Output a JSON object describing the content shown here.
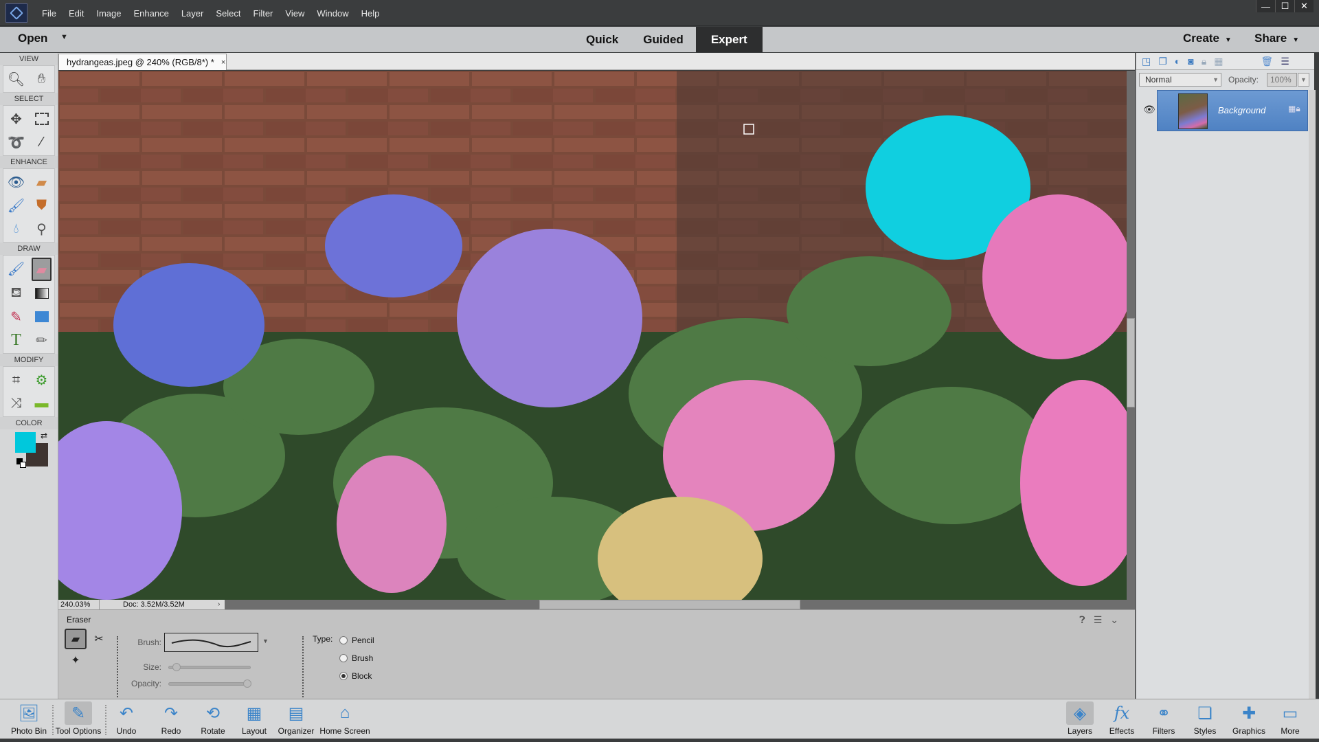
{
  "menu": [
    "File",
    "Edit",
    "Image",
    "Enhance",
    "Layer",
    "Select",
    "Filter",
    "View",
    "Window",
    "Help"
  ],
  "window_controls": {
    "minimize": "—",
    "maximize": "☐",
    "close": "✕"
  },
  "modebar": {
    "open": "Open",
    "modes": [
      "Quick",
      "Guided",
      "Expert"
    ],
    "active_mode": "Expert",
    "create": "Create",
    "share": "Share"
  },
  "document": {
    "tab_title": "hydrangeas.jpeg @ 240% (RGB/8*) *",
    "close": "×",
    "zoom": "240.03%",
    "doc_size": "Doc: 3.52M/3.52M"
  },
  "toolbox": {
    "sections": {
      "view": "VIEW",
      "select": "SELECT",
      "enhance": "ENHANCE",
      "draw": "DRAW",
      "modify": "MODIFY",
      "color": "COLOR"
    },
    "foreground_color": "#00c8dc",
    "background_color": "#3e3430",
    "active_tool": "eraser"
  },
  "tool_options": {
    "title": "Eraser",
    "brush_label": "Brush:",
    "size_label": "Size:",
    "opacity_label": "Opacity:",
    "type_label": "Type:",
    "size_value_fraction": 0.05,
    "opacity_value_fraction": 1.0,
    "types": [
      {
        "label": "Pencil",
        "selected": false
      },
      {
        "label": "Brush",
        "selected": false
      },
      {
        "label": "Block",
        "selected": true
      }
    ]
  },
  "layers_panel": {
    "blend_mode": "Normal",
    "opacity_label": "Opacity:",
    "opacity_value": "100%",
    "layers": [
      {
        "name": "Background",
        "visible": true,
        "locked": true
      }
    ]
  },
  "bottom_left": [
    {
      "label": "Photo Bin",
      "icon": "photo-bin-icon"
    },
    {
      "label": "Tool Options",
      "icon": "tool-options-icon",
      "active": true
    },
    {
      "label": "Undo",
      "icon": "undo-icon"
    },
    {
      "label": "Redo",
      "icon": "redo-icon"
    },
    {
      "label": "Rotate",
      "icon": "rotate-icon"
    },
    {
      "label": "Layout",
      "icon": "layout-icon"
    },
    {
      "label": "Organizer",
      "icon": "organizer-icon"
    },
    {
      "label": "Home Screen",
      "icon": "home-icon"
    }
  ],
  "bottom_right": [
    {
      "label": "Layers",
      "icon": "layers-icon",
      "active": true
    },
    {
      "label": "Effects",
      "icon": "effects-icon"
    },
    {
      "label": "Filters",
      "icon": "filters-icon"
    },
    {
      "label": "Styles",
      "icon": "styles-icon"
    },
    {
      "label": "Graphics",
      "icon": "graphics-icon"
    },
    {
      "label": "More",
      "icon": "more-icon"
    }
  ]
}
